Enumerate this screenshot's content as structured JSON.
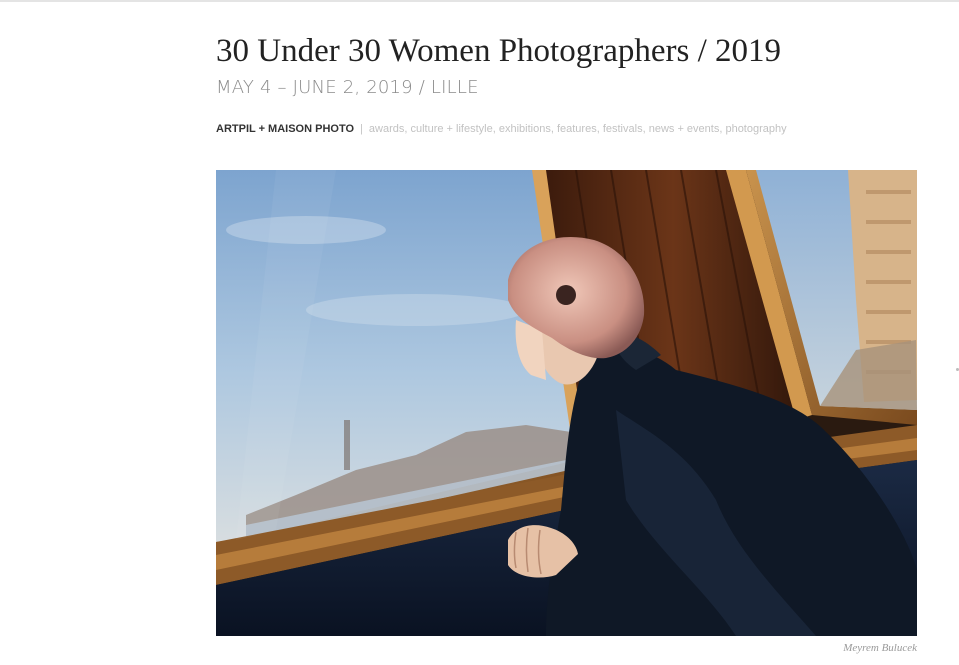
{
  "article": {
    "title": "30 Under 30 Women Photographers / 2019",
    "subtitle": "MAY 4 – JUNE 2, 2019 / LILLE",
    "author": "ARTPIL + MAISON PHOTO",
    "separator": "|",
    "tags": [
      "awards",
      "culture + lifestyle",
      "exhibitions",
      "features",
      "festivals",
      "news + events",
      "photography"
    ]
  },
  "photo": {
    "alt": "Woman with pinned-up hair in a dark jacket looking out of a ferry window at a city skyline",
    "credit": "Meyrem Bulucek"
  },
  "colors": {
    "title": "#222222",
    "subtitle": "#8a8a8a",
    "tags": "#c2c2c2",
    "author": "#333333"
  }
}
